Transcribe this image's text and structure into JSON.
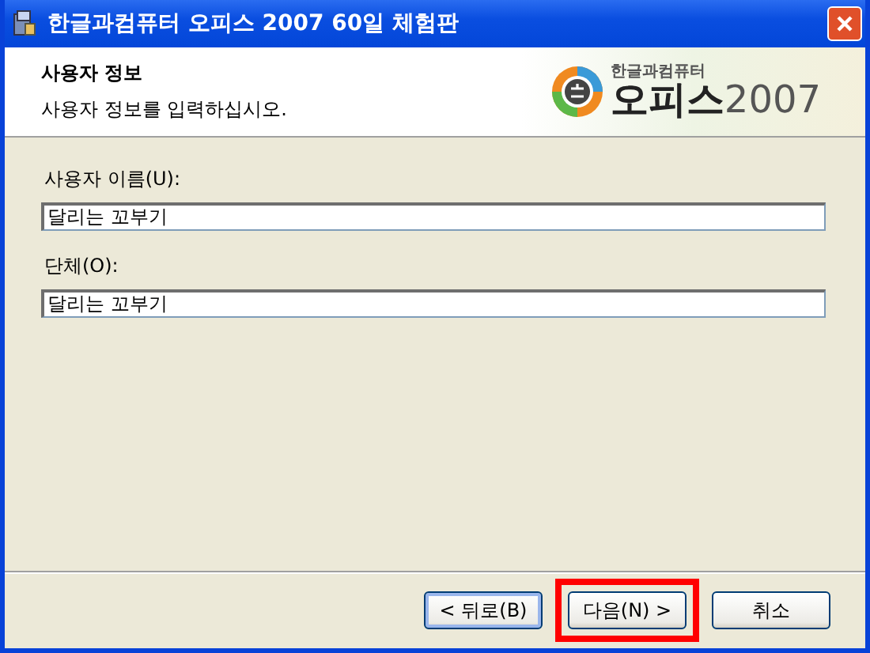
{
  "window": {
    "title": "한글과컴퓨터 오피스 2007 60일 체험판"
  },
  "header": {
    "title": "사용자 정보",
    "subtitle": "사용자 정보를 입력하십시오.",
    "logo": {
      "company": "한글과컴퓨터",
      "product": "오피스",
      "version": "2007"
    }
  },
  "fields": [
    {
      "label": "사용자 이름(U):",
      "value": "달리는 꼬부기"
    },
    {
      "label": "단체(O):",
      "value": "달리는 꼬부기"
    }
  ],
  "buttons": [
    {
      "label": "< 뒤로(B)",
      "focused": true,
      "highlighted": false
    },
    {
      "label": "다음(N) >",
      "focused": false,
      "highlighted": true
    },
    {
      "label": "취소",
      "focused": false,
      "highlighted": false
    }
  ]
}
